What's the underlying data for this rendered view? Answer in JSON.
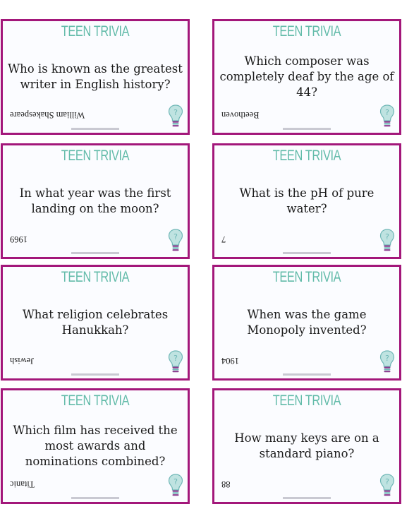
{
  "colors": {
    "border": "#a3177a",
    "title": "#62bba9",
    "bulb": "#a9d9d8"
  },
  "icon": "lightbulb-question-icon",
  "cards": [
    {
      "title": "TEEN TRIVIA",
      "question": "Who is known as the greatest writer in English history?",
      "answer": "William Shakespeare"
    },
    {
      "title": "TEEN TRIVIA",
      "question": "Which composer was completely deaf by the age of 44?",
      "answer": "Beethoven"
    },
    {
      "title": "TEEN TRIVIA",
      "question": "In what year was the first landing on the moon?",
      "answer": "1969"
    },
    {
      "title": "TEEN TRIVIA",
      "question": "What is the pH of pure water?",
      "answer": "7"
    },
    {
      "title": "TEEN TRIVIA",
      "question": "What religion celebrates Hanukkah?",
      "answer": "Jewish"
    },
    {
      "title": "TEEN TRIVIA",
      "question": "When was the game Monopoly invented?",
      "answer": "1904"
    },
    {
      "title": "TEEN TRIVIA",
      "question": "Which film has received the most awards and nominations combined?",
      "answer": "Titanic"
    },
    {
      "title": "TEEN TRIVIA",
      "question": "How many keys are on a standard piano?",
      "answer": "88"
    }
  ]
}
